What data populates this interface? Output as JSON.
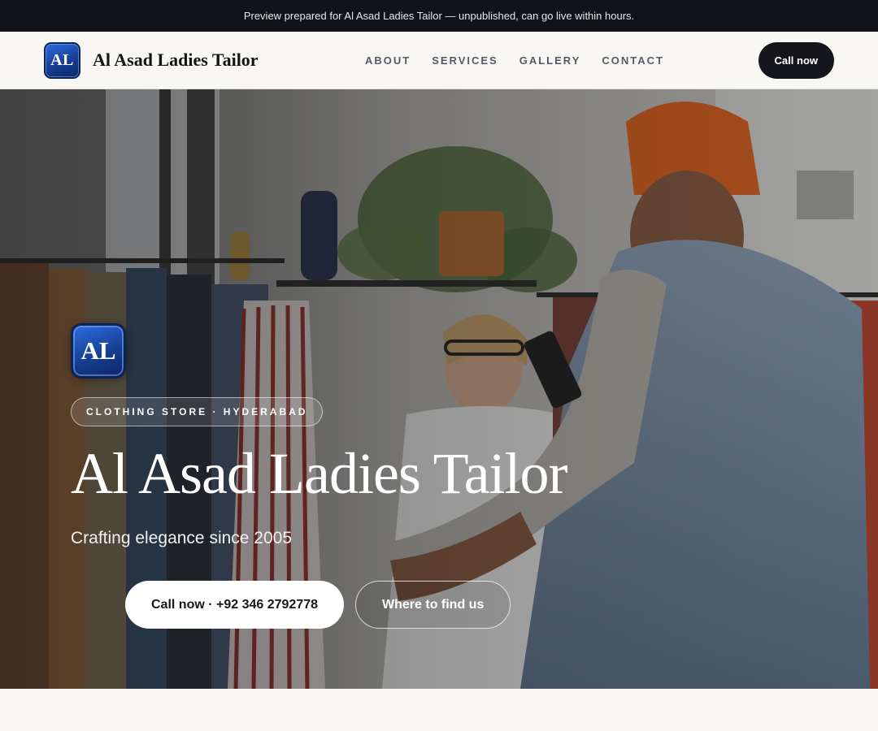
{
  "banner": {
    "text": "Preview prepared for Al Asad Ladies Tailor — unpublished, can go live within hours."
  },
  "nav": {
    "logo_initials": "AL",
    "brand_name": "Al Asad Ladies Tailor",
    "links": [
      "ABOUT",
      "SERVICES",
      "GALLERY",
      "CONTACT"
    ],
    "cta_label": "Call now"
  },
  "hero": {
    "logo_initials": "AL",
    "tag": "CLOTHING STORE · HYDERABAD",
    "title": "Al Asad Ladies Tailor",
    "subtitle": "Crafting elegance since 2005",
    "primary_button": "Call now · +92 346 2792778",
    "secondary_button": "Where to find us",
    "photo_icon": "clothing-store-photo"
  },
  "colors": {
    "banner_bg": "#111318",
    "nav_bg": "#f8f7f4",
    "cta_bg": "#14161b",
    "logo_blue": "#173f94"
  }
}
